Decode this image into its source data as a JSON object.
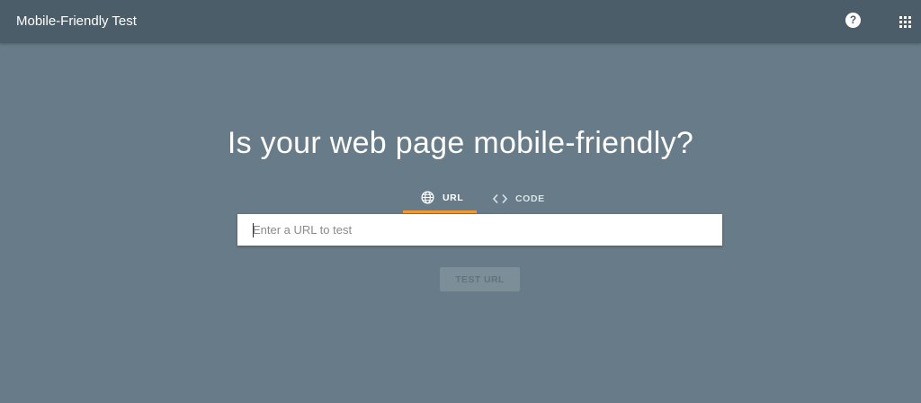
{
  "header": {
    "title": "Mobile-Friendly Test",
    "help_icon": "help-circle-icon",
    "help_glyph": "?",
    "apps_icon": "apps-grid-icon"
  },
  "main": {
    "headline": "Is your web page mobile-friendly?",
    "tabs": [
      {
        "label": "URL",
        "icon": "globe-icon",
        "selected": true
      },
      {
        "label": "CODE",
        "icon": "code-brackets-icon",
        "selected": false
      }
    ],
    "url_input": {
      "placeholder": "Enter a URL to test",
      "value": ""
    },
    "test_button": {
      "label": "TEST URL",
      "disabled": true
    }
  },
  "colors": {
    "background": "#677c88",
    "header": "#4b5d68",
    "tab_indicator": "#f29a30"
  }
}
